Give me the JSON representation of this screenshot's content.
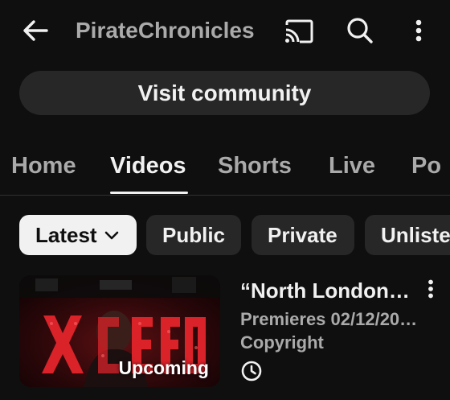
{
  "header": {
    "channel_title": "PirateChronicles",
    "icons": [
      "back-arrow-icon",
      "cast-icon",
      "search-icon",
      "more-vert-icon"
    ]
  },
  "community": {
    "label": "Visit community"
  },
  "tabs": [
    {
      "label": "Home",
      "active": false
    },
    {
      "label": "Videos",
      "active": true
    },
    {
      "label": "Shorts",
      "active": false
    },
    {
      "label": "Live",
      "active": false
    },
    {
      "label": "Po",
      "active": false
    }
  ],
  "filters": [
    {
      "label": "Latest",
      "selected": true
    },
    {
      "label": "Public",
      "selected": false
    },
    {
      "label": "Private",
      "selected": false
    },
    {
      "label": "Unliste",
      "selected": false
    }
  ],
  "video": {
    "title": "“North London…",
    "badge": "Upcoming",
    "premiere": "Premieres 02/12/20…",
    "status": "Copyright",
    "thumbnail_text": "X CEO",
    "icon": "clock-icon"
  },
  "colors": {
    "background": "#0f0f0f",
    "surface": "#272727",
    "text_primary": "#f1f1f1",
    "text_secondary": "#aaaaaa",
    "accent_red": "#e3242b"
  }
}
